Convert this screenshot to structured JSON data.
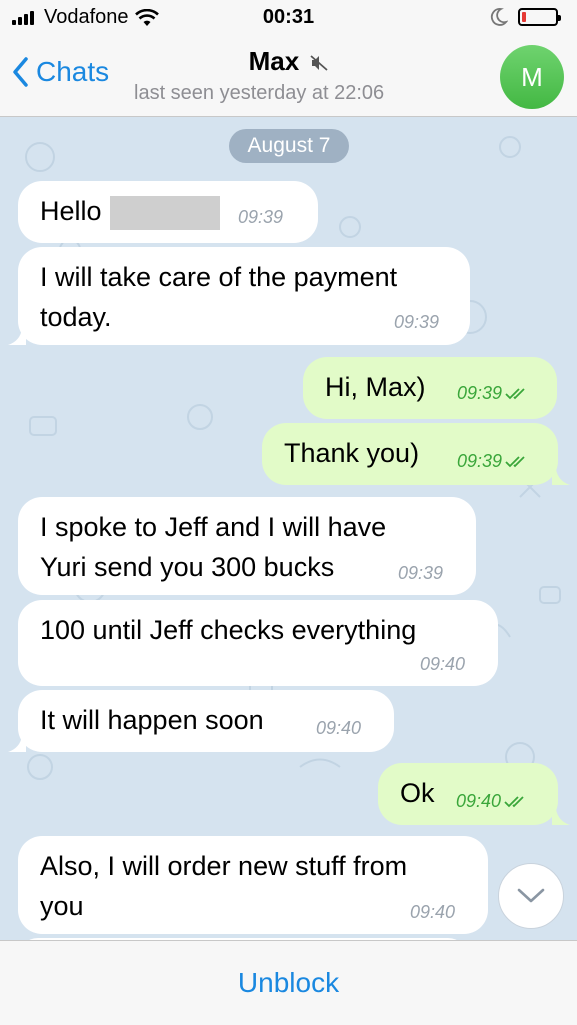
{
  "status_bar": {
    "carrier": "Vodafone",
    "time": "00:31",
    "battery_color": "#e53935"
  },
  "nav": {
    "back_label": "Chats",
    "title": "Max",
    "subtitle": "last seen yesterday at 22:06",
    "avatar_letter": "M",
    "avatar_color": "#43b843",
    "accent": "#1a88e0"
  },
  "chat": {
    "date": "August 7",
    "messages": [
      {
        "dir": "in",
        "text": "Hello",
        "time": "09:39",
        "redacted": true
      },
      {
        "dir": "in",
        "text": "I will take care of the payment\ntoday.",
        "time": "09:39"
      },
      {
        "dir": "out",
        "text": "Hi, Max)",
        "time": "09:39",
        "read": true
      },
      {
        "dir": "out",
        "text": "Thank you)",
        "time": "09:39",
        "read": true
      },
      {
        "dir": "in",
        "text": "I spoke to Jeff and I will have\nYuri send you 300 bucks",
        "time": "09:39"
      },
      {
        "dir": "in",
        "text": "100 until Jeff checks everything",
        "time": "09:40"
      },
      {
        "dir": "in",
        "text": "It will happen soon",
        "time": "09:40"
      },
      {
        "dir": "out",
        "text": "Ok",
        "time": "09:40",
        "read": true
      },
      {
        "dir": "in",
        "text": "Also, I will order new stuff from\nyou",
        "time": "09:40"
      }
    ]
  },
  "bottom": {
    "unblock_label": "Unblock"
  }
}
